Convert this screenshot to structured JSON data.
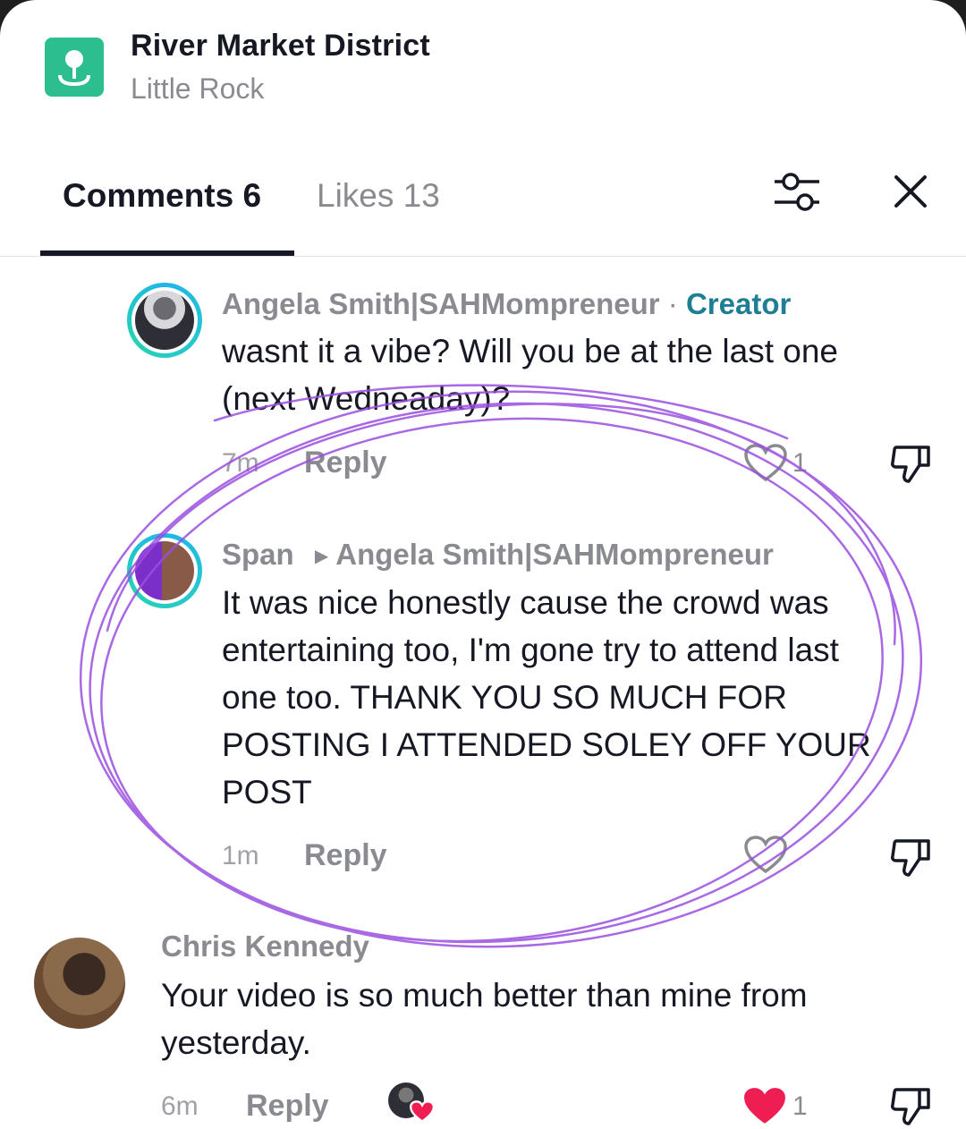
{
  "location": {
    "title": "River Market District",
    "subtitle": "Little Rock",
    "icon": "location-pin-icon",
    "icon_color": "#2dbe8f"
  },
  "tabs": {
    "comments_label": "Comments 6",
    "likes_label": "Likes 13"
  },
  "toolbar": {
    "filter_icon": "sliders-icon",
    "close_icon": "close-icon"
  },
  "comments": [
    {
      "author": "Angela Smith|SAHMompreneur",
      "separator": " · ",
      "badge": "Creator",
      "text": "wasnt it a vibe? Will you be at the last one (next Wedneaday)?",
      "time": "7m",
      "reply_label": "Reply",
      "likes": "1"
    },
    {
      "author": "Span",
      "reply_to": "Angela Smith|SAHMompreneur",
      "text": "It was nice honestly cause the crowd was entertaining too, I'm gone try to attend last one too. THANK YOU SO MUCH FOR POSTING I ATTENDED SOLEY OFF YOUR POST",
      "time": "1m",
      "reply_label": "Reply"
    },
    {
      "author": "Chris Kennedy",
      "text": "Your video is so much better than mine from yesterday.",
      "time": "6m",
      "reply_label": "Reply",
      "likes": "1",
      "liked": true
    }
  ],
  "colors": {
    "creator_badge": "#1d7e94",
    "liked_heart": "#ee1d52",
    "annotation_scribble": "#9b4fe0",
    "avatar_ring": "#1fb6e8"
  }
}
